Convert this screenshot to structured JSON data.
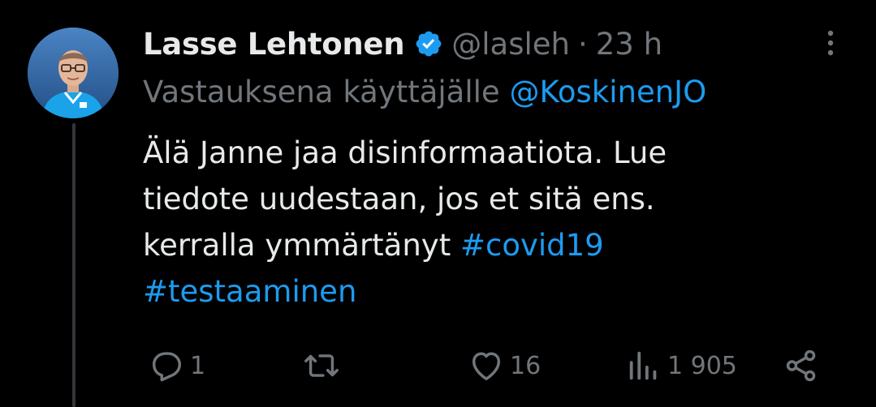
{
  "tweet": {
    "author": {
      "display_name": "Lasse Lehtonen",
      "handle": "@lasleh",
      "separator": "·",
      "time": "23 h",
      "verified": true
    },
    "reply_to": {
      "prefix": "Vastauksena käyttäjälle",
      "mention": "@KoskinenJO"
    },
    "text": {
      "line1": "Älä Janne jaa disinformaatiota. Lue",
      "line2": "tiedote uudestaan, jos et sitä ens.",
      "line3_text": "kerralla ymmärtänyt ",
      "hashtag1": "#covid19",
      "hashtag2": "#testaaminen"
    },
    "actions": {
      "replies": "1",
      "retweets": "",
      "likes": "16",
      "views": "1 905"
    }
  },
  "icons": {
    "verified": "verified-badge-icon",
    "more": "more-vertical-icon",
    "reply": "comment-icon",
    "retweet": "retweet-icon",
    "like": "heart-icon",
    "views": "views-chart-icon",
    "share": "share-icon"
  },
  "colors": {
    "background": "#000000",
    "primary_text": "#e7e9ea",
    "secondary_text": "#71767b",
    "accent": "#1d9bf0",
    "thread_line": "#333639"
  }
}
